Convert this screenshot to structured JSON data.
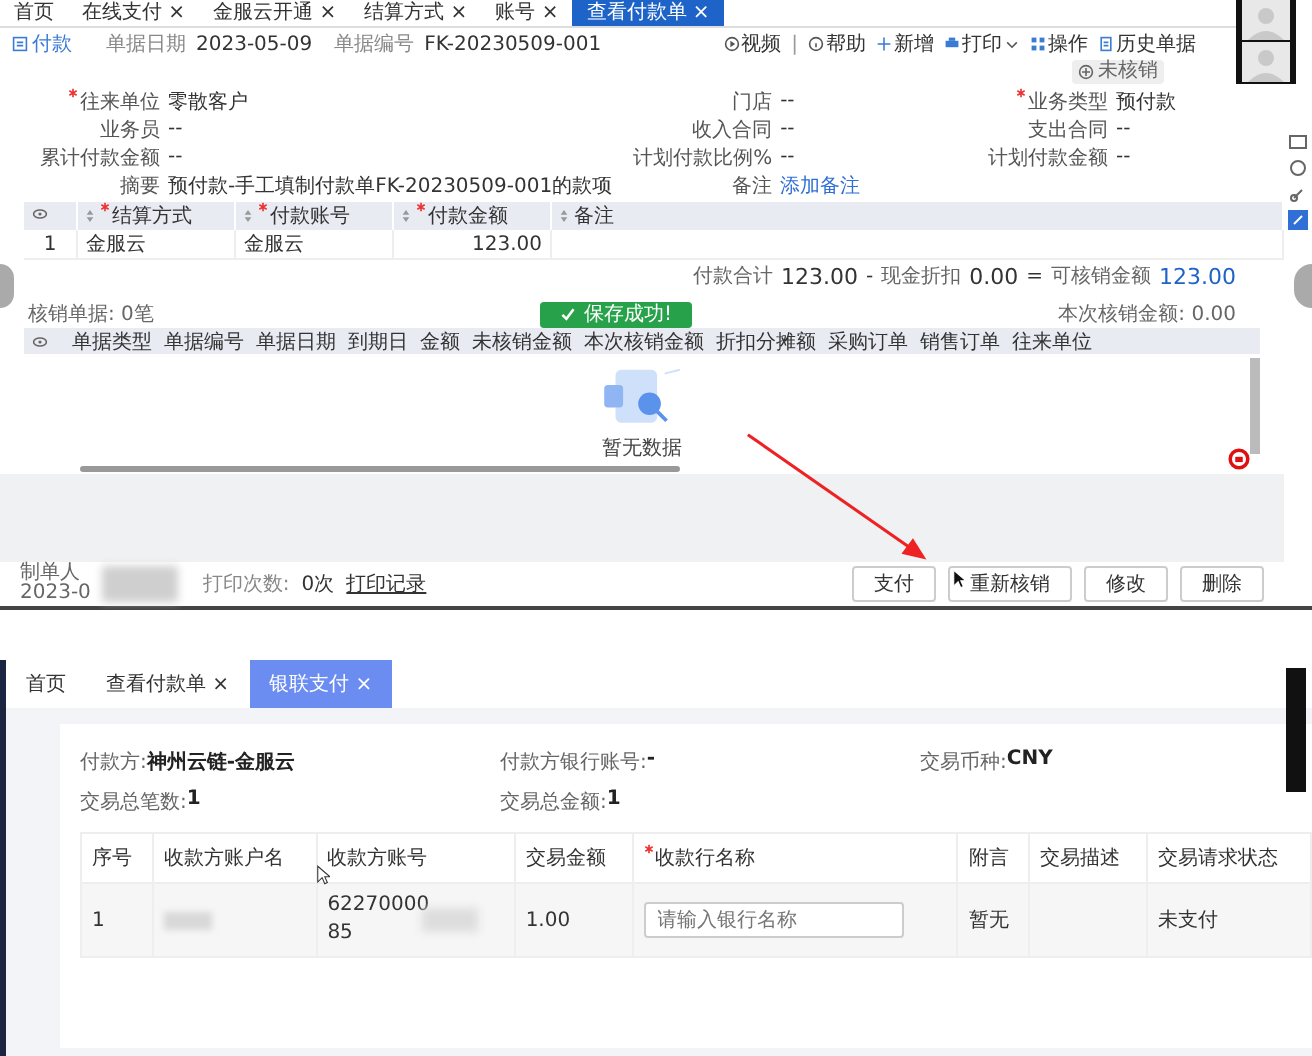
{
  "top": {
    "tabs": [
      {
        "label": "首页",
        "selected": false
      },
      {
        "label": "在线支付",
        "close": "×",
        "selected": false
      },
      {
        "label": "金服云开通",
        "close": "×",
        "selected": false
      },
      {
        "label": "结算方式",
        "close": "×",
        "selected": false
      },
      {
        "label": "账号",
        "close": "×",
        "selected": false
      },
      {
        "label": "查看付款单",
        "close": "×",
        "selected": true
      }
    ],
    "doc": {
      "title": "付款",
      "date_label": "单据日期",
      "date": "2023-05-09",
      "no_label": "单据编号",
      "no": "FK-20230509-001"
    },
    "toolbar": [
      {
        "kind": "video",
        "label": "视频"
      },
      {
        "kind": "sep",
        "label": "|"
      },
      {
        "kind": "help",
        "label": "帮助"
      },
      {
        "kind": "add",
        "label": "新增"
      },
      {
        "kind": "print",
        "label": "打印",
        "dropdown": true
      },
      {
        "kind": "ops",
        "label": "操作"
      },
      {
        "kind": "history",
        "label": "历史单据"
      }
    ],
    "status_badge": "未核销",
    "form": [
      [
        {
          "label": "往来单位",
          "value": "零散客户",
          "required": true
        },
        {
          "label": "门店",
          "value": "--",
          "required": false
        },
        {
          "label": "业务类型",
          "value": "预付款",
          "required": true
        }
      ],
      [
        {
          "label": "业务员",
          "value": "--",
          "required": false
        },
        {
          "label": "收入合同",
          "value": "--",
          "required": false
        },
        {
          "label": "支出合同",
          "value": "--",
          "required": false
        }
      ],
      [
        {
          "label": "累计付款金额",
          "value": "--",
          "required": false
        },
        {
          "label": "计划付款比例%",
          "value": "--",
          "required": false
        },
        {
          "label": "计划付款金额",
          "value": "--",
          "required": false
        }
      ],
      [
        {
          "label": "摘要",
          "value": "预付款-手工填制付款单FK-20230509-001的款项",
          "required": false
        },
        {
          "label": "备注",
          "link": "添加备注",
          "required": false
        }
      ]
    ],
    "pay_table": {
      "columns": [
        {
          "kind": "eye"
        },
        {
          "label": "结算方式",
          "required": true
        },
        {
          "label": "付款账号",
          "required": true
        },
        {
          "label": "付款金额",
          "required": true
        },
        {
          "label": "备注",
          "required": false
        }
      ],
      "rows": [
        [
          "1",
          "金服云",
          "金服云",
          "123.00"
        ]
      ]
    },
    "totals": [
      {
        "label": "付款合计",
        "value": "123.00",
        "highlight": false
      },
      {
        "op": "-"
      },
      {
        "label": "现金折扣",
        "value": "0.00",
        "highlight": false
      },
      {
        "op": "="
      },
      {
        "label": "可核销金额",
        "value": "123.00",
        "highlight": true
      }
    ],
    "writeoff_count": "核销单据: 0笔",
    "writeoff_amount": "本次核销金额: 0.00",
    "writeoff_columns": [
      "单据类型",
      "单据编号",
      "单据日期",
      "到期日",
      "金额",
      "未核销金额",
      "本次核销金额",
      "折扣分摊额",
      "采购订单",
      "销售订单",
      "往来单位"
    ],
    "empty_text": "暂无数据",
    "toast": "保存成功!",
    "footer": {
      "maker_label": "制单人",
      "maker_date": "2023-0",
      "print_label": "打印次数:",
      "print_count": "0次",
      "print_link": "打印记录"
    },
    "buttons": [
      "支付",
      "重新核销",
      "修改",
      "删除"
    ]
  },
  "bottom": {
    "tabs": [
      {
        "label": "首页",
        "selected": false
      },
      {
        "label": "查看付款单",
        "close": "×",
        "selected": false
      },
      {
        "label": "银联支付",
        "close": "×",
        "selected": true
      }
    ],
    "info": [
      {
        "label": "付款方:",
        "value": "神州云链-金服云"
      },
      {
        "label": "付款方银行账号:",
        "value": "-"
      },
      {
        "label": "交易币种:",
        "value": "CNY"
      },
      {
        "label": "交易总笔数:",
        "value": "1"
      },
      {
        "label": "交易总金额:",
        "value": "1"
      }
    ],
    "columns": [
      {
        "label": "序号",
        "required": false
      },
      {
        "label": "收款方账户名",
        "required": false
      },
      {
        "label": "收款方账号",
        "required": false
      },
      {
        "label": "交易金额",
        "required": false
      },
      {
        "label": "收款行名称",
        "required": true
      },
      {
        "label": "附言",
        "required": false
      },
      {
        "label": "交易描述",
        "required": false
      },
      {
        "label": "交易请求状态",
        "required": false
      }
    ],
    "row": {
      "no": "1",
      "account_lines": [
        "62270000",
        "85"
      ],
      "amount": "1.00",
      "bank_placeholder": "请输入银行名称",
      "note": "暂无",
      "status": "未支付"
    }
  }
}
